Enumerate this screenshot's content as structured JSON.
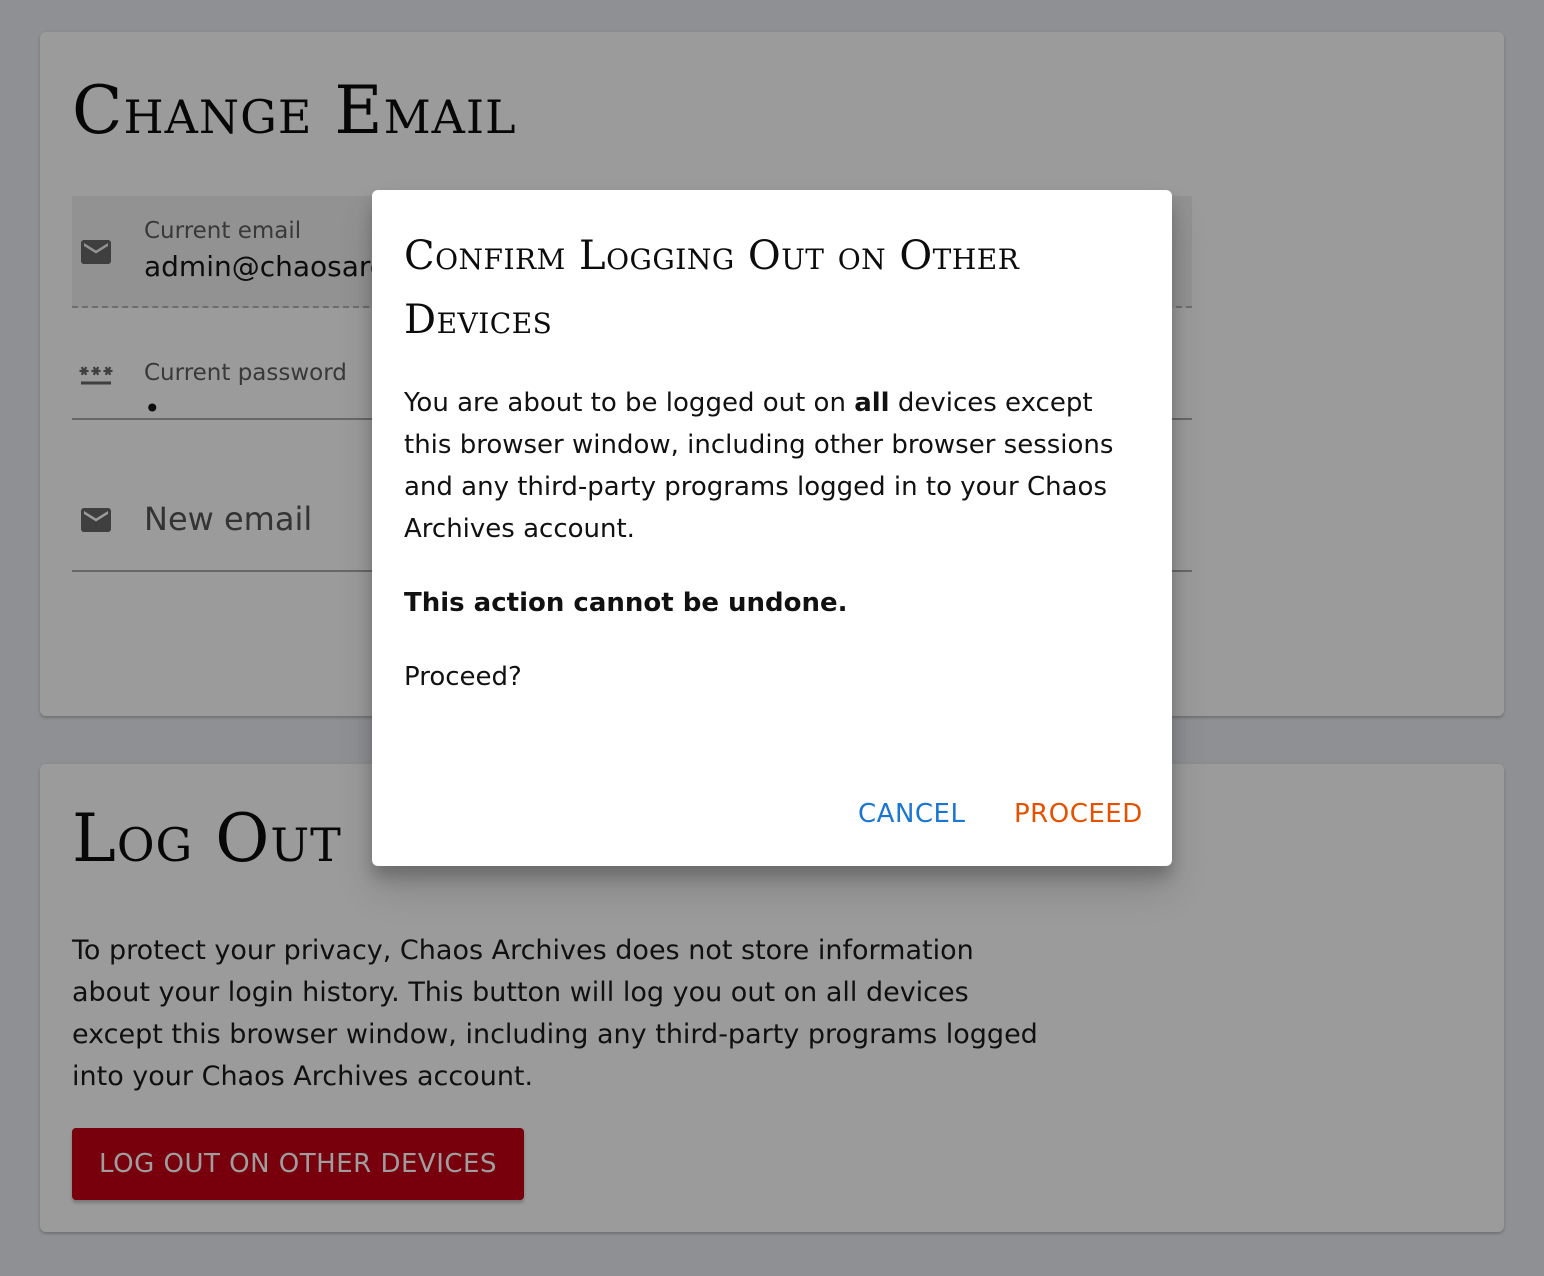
{
  "change_email": {
    "title": "Change Email",
    "current_email": {
      "label": "Current email",
      "value": "admin@chaosarchives.org",
      "icon": "mail-icon"
    },
    "current_password": {
      "label": "Current password",
      "value": "•",
      "icon": "password-icon"
    },
    "new_email": {
      "placeholder": "New email",
      "icon": "mail-icon"
    }
  },
  "log_out": {
    "title": "Log Out",
    "description": "To protect your privacy, Chaos Archives does not store information about your login history. This button will log you out on all devices except this browser window, including any third-party programs logged into your Chaos Archives account.",
    "button_label": "LOG OUT ON OTHER DEVICES",
    "button_color": "#c00014"
  },
  "dialog": {
    "title": "Confirm Logging Out on Other Devices",
    "body_before": "You are about to be logged out on ",
    "body_emphasis": "all",
    "body_after": " devices except this browser window, including other browser sessions and any third-party programs logged in to your Chaos Archives account.",
    "warning": "This action cannot be undone.",
    "question": "Proceed?",
    "cancel_label": "CANCEL",
    "proceed_label": "PROCEED",
    "cancel_color": "#1976d2",
    "proceed_color": "#e65100"
  }
}
